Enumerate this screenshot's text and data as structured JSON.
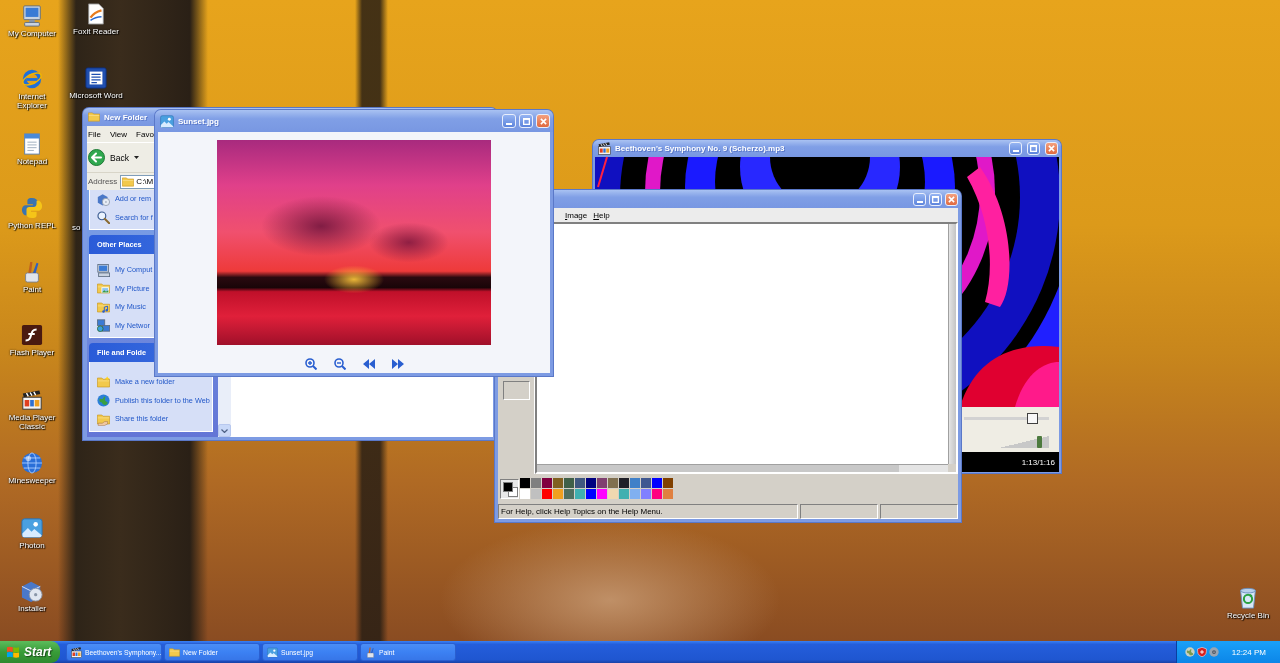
{
  "desktop_icons": [
    {
      "label": "My Computer"
    },
    {
      "label": "Internet Explorer"
    },
    {
      "label": "Notepad"
    },
    {
      "label": "Python REPL"
    },
    {
      "label": "Paint"
    },
    {
      "label": "Flash Player"
    },
    {
      "label": "Media Player Classic"
    },
    {
      "label": "Minesweeper"
    },
    {
      "label": "Photon"
    },
    {
      "label": "Installer"
    },
    {
      "label": "Foxit Reader"
    },
    {
      "label": "Microsoft Word"
    },
    {
      "label": "so"
    },
    {
      "label": "Recycle Bin"
    }
  ],
  "media_player_window": {
    "title": "Beethoven's Symphony No. 9 (Scherzo).mp3",
    "seek": {
      "level": 0.8
    },
    "volume": {
      "level": 0.8
    },
    "time": "1:13/1:16"
  },
  "explorer_window": {
    "title": "New Folder",
    "menu": [
      "File",
      "View",
      "Favo"
    ],
    "back_button": "Back",
    "address_label": "Address",
    "address": "C:\\M",
    "task_groups": [
      {
        "items": [
          "Add or rem",
          "Search for f"
        ]
      },
      {
        "title": "Other Places",
        "items": [
          "My Comput",
          "My Picture",
          "My Music",
          "My Networ"
        ]
      },
      {
        "title": "File and Folde",
        "items": [
          "Make a new folder",
          "Publish this folder to the Web",
          "Share this folder"
        ]
      }
    ]
  },
  "paint_window": {
    "menu": [
      "Image",
      "Help"
    ],
    "current_colors": [
      {
        "color": "#000000"
      },
      {
        "color": "#ffffff"
      }
    ],
    "palette": [
      {
        "color": "#000000"
      },
      {
        "color": "#808080"
      },
      {
        "color": "#800040"
      },
      {
        "color": "#806020"
      },
      {
        "color": "#406048"
      },
      {
        "color": "#405880"
      },
      {
        "color": "#000080"
      },
      {
        "color": "#804070"
      },
      {
        "color": "#807050"
      },
      {
        "color": "#202028"
      },
      {
        "color": "#4080c8"
      },
      {
        "color": "#405890"
      },
      {
        "color": "#0000ff"
      },
      {
        "color": "#804000"
      },
      {
        "color": "#ffffff"
      },
      {
        "color": "#c0c0c0"
      },
      {
        "color": "#ff0000"
      },
      {
        "color": "#f0a020"
      },
      {
        "color": "#507060"
      },
      {
        "color": "#40b0b0"
      },
      {
        "color": "#0000ff"
      },
      {
        "color": "#ff00ff"
      },
      {
        "color": "#f0d8b0"
      },
      {
        "color": "#40b0b0"
      },
      {
        "color": "#80b0f0"
      },
      {
        "color": "#8080ff"
      },
      {
        "color": "#ff0080"
      },
      {
        "color": "#e08040"
      }
    ],
    "status_text": "For Help, click Help Topics on the Help Menu."
  },
  "image_viewer_window": {
    "title": "Sunset.jpg"
  },
  "taskbar": {
    "start_button": "Start",
    "tasks": [
      {
        "label": "Beethoven's Symphony...",
        "selected": false
      },
      {
        "label": "New Folder",
        "selected": false
      },
      {
        "label": "Sunset.jpg",
        "selected": false
      },
      {
        "label": "Paint",
        "selected": false
      }
    ],
    "clock": "12:24 PM"
  }
}
